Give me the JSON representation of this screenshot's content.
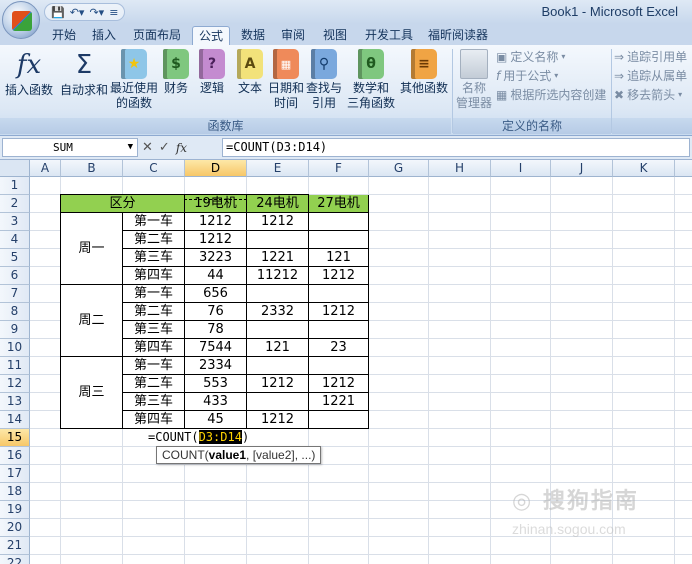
{
  "window": {
    "title": "Book1 - Microsoft Excel"
  },
  "ribbon": {
    "tabs": [
      "开始",
      "插入",
      "页面布局",
      "公式",
      "数据",
      "审阅",
      "视图",
      "开发工具",
      "福昕阅读器"
    ],
    "active_tab": "公式",
    "function_library": {
      "insert_function": "插入函数",
      "autosum_l1": "自动求和",
      "autosum_l2": "",
      "recent_l1": "最近使用",
      "recent_l2": "的函数",
      "finance": "财务",
      "logic": "逻辑",
      "text": "文本",
      "datetime_l1": "日期和",
      "datetime_l2": "时间",
      "lookup_l1": "查找与",
      "lookup_l2": "引用",
      "math_l1": "数学和",
      "math_l2": "三角函数",
      "other": "其他函数",
      "group_label": "函数库"
    },
    "defined_names": {
      "name_manager_l1": "名称",
      "name_manager_l2": "管理器",
      "define_name": "定义名称",
      "use_in_formula": "用于公式",
      "create_from_selection": "根据所选内容创建",
      "group_label": "定义的名称"
    },
    "auditing": {
      "trace_precedents": "追踪引用单",
      "trace_dependents": "追踪从属单",
      "remove_arrows": "移去箭头"
    }
  },
  "formula_bar": {
    "name_box": "SUM",
    "formula": "=COUNT(D3:D14)"
  },
  "columns": [
    "A",
    "B",
    "C",
    "D",
    "E",
    "F",
    "G",
    "H",
    "I",
    "J",
    "K",
    "L"
  ],
  "rows": [
    "1",
    "2",
    "3",
    "4",
    "5",
    "6",
    "7",
    "8",
    "9",
    "10",
    "11",
    "12",
    "13",
    "14",
    "15",
    "16",
    "17",
    "18",
    "19",
    "20",
    "21",
    "22"
  ],
  "table": {
    "headers": {
      "category": "区分",
      "col_d": "19电机",
      "col_e": "24电机",
      "col_f": "27电机"
    },
    "days": [
      "周一",
      "周二",
      "周三"
    ],
    "cars": [
      [
        "第一车",
        "1212",
        "1212",
        ""
      ],
      [
        "第二车",
        "1212",
        "",
        ""
      ],
      [
        "第三车",
        "3223",
        "1221",
        "121"
      ],
      [
        "第四车",
        "44",
        "11212",
        "1212"
      ],
      [
        "第一车",
        "656",
        "",
        ""
      ],
      [
        "第二车",
        "76",
        "2332",
        "1212"
      ],
      [
        "第三车",
        "78",
        "",
        ""
      ],
      [
        "第四车",
        "7544",
        "121",
        "23"
      ],
      [
        "第一车",
        "2334",
        "",
        ""
      ],
      [
        "第二车",
        "553",
        "1212",
        "1212"
      ],
      [
        "第三车",
        "433",
        "",
        "1221"
      ],
      [
        "第四车",
        "45",
        "1212",
        ""
      ]
    ]
  },
  "editing": {
    "prefix": "=COUNT(",
    "ref": "D3:D14",
    "suffix": ")"
  },
  "tooltip": {
    "func": "COUNT(",
    "arg1": "value1",
    "rest": ", [value2], ...)"
  },
  "watermark": {
    "text": "搜狗指南",
    "url": "zhinan.sogou.com"
  }
}
